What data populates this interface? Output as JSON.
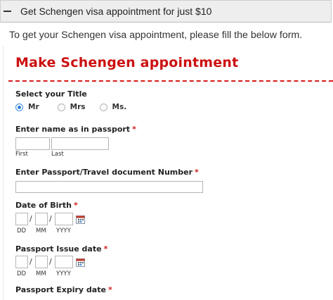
{
  "accordion": {
    "title": "Get Schengen visa appointment for just $10",
    "icon": "minus-icon"
  },
  "intro_text": "To get your Schengen visa appointment, please fill the below form.",
  "form": {
    "title": "Make Schengen appointment",
    "accent_color": "#cc1111",
    "title_section": {
      "label": "Select your Title",
      "options": [
        "Mr",
        "Mrs",
        "Ms."
      ],
      "selected": "Mr"
    },
    "name": {
      "label": "Enter name as in passport",
      "required_mark": "*",
      "first_value": "",
      "last_value": "",
      "first_sublabel": "First",
      "last_sublabel": "Last"
    },
    "passport_number": {
      "label": "Enter Passport/Travel document Number",
      "required_mark": "*",
      "value": ""
    },
    "date_of_birth": {
      "label": "Date of Birth",
      "required_mark": "*",
      "separator": "/",
      "dd": "DD",
      "mm": "MM",
      "yyyy": "YYYY",
      "icon": "calendar-icon"
    },
    "passport_issue_date": {
      "label": "Passport Issue date",
      "required_mark": "*",
      "separator": "/",
      "dd": "DD",
      "mm": "MM",
      "yyyy": "YYYY",
      "icon": "calendar-icon"
    },
    "passport_expiry_date": {
      "label": "Passport Expiry date",
      "required_mark": "*"
    }
  }
}
